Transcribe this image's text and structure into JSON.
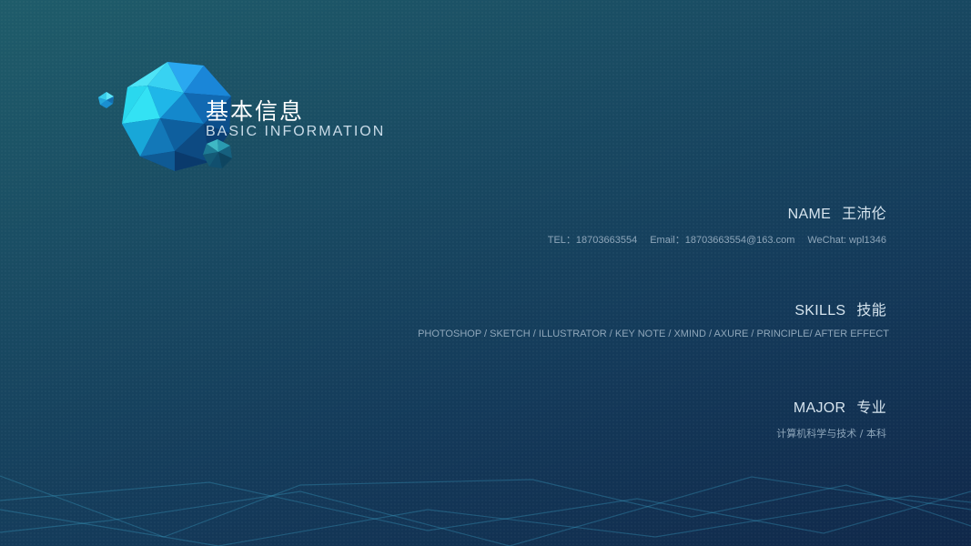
{
  "header": {
    "title_cn": "基本信息",
    "title_en": "BASIC INFORMATION"
  },
  "name_section": {
    "label": "NAME",
    "value": "王沛伦",
    "tel": "TEL：18703663554",
    "email": "Email：18703663554@163.com",
    "wechat": "WeChat: wpl1346"
  },
  "skills_section": {
    "label": "SKILLS",
    "value": "技能",
    "list": "PHOTOSHOP / SKETCH / ILLUSTRATOR / KEY NOTE / XMIND / AXURE / PRINCIPLE/ AFTER EFFECT"
  },
  "major_section": {
    "label": "MAJOR",
    "value": "专业",
    "detail": "计算机科学与技术 / 本科"
  },
  "decorations": {
    "icons": [
      "low-poly-sphere-icon",
      "small-gem-icon",
      "mid-gem-icon"
    ],
    "colors": {
      "gem_cyan": "#2fe0f0",
      "gem_blue": "#1c8fe0",
      "gem_dark": "#0f4b86",
      "line": "#3aa6c8"
    }
  }
}
